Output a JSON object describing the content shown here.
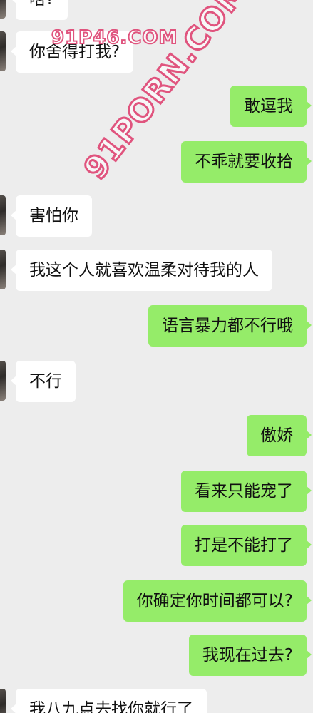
{
  "watermarks": {
    "top": "91P46.COM",
    "diagonal": "91PORN.COM"
  },
  "colors": {
    "background": "#ededed",
    "incoming_bubble": "#ffffff",
    "outgoing_bubble": "#95ec69",
    "text": "#111111"
  },
  "messages": [
    {
      "side": "left",
      "avatar": true,
      "text": "啥?"
    },
    {
      "side": "left",
      "avatar": true,
      "text": "你舍得打我?"
    },
    {
      "side": "right",
      "avatar": false,
      "text": "敢逗我"
    },
    {
      "side": "right",
      "avatar": false,
      "text": "不乖就要收拾"
    },
    {
      "side": "left",
      "avatar": true,
      "text": "害怕你"
    },
    {
      "side": "left",
      "avatar": true,
      "text": "我这个人就喜欢温柔对待我的人"
    },
    {
      "side": "right",
      "avatar": false,
      "text": "语言暴力都不行哦"
    },
    {
      "side": "left",
      "avatar": true,
      "text": "不行"
    },
    {
      "side": "right",
      "avatar": false,
      "text": "傲娇"
    },
    {
      "side": "right",
      "avatar": false,
      "text": "看来只能宠了"
    },
    {
      "side": "right",
      "avatar": false,
      "text": "打是不能打了"
    },
    {
      "side": "right",
      "avatar": false,
      "text": "你确定你时间都可以?"
    },
    {
      "side": "right",
      "avatar": false,
      "text": "我现在过去?"
    },
    {
      "side": "left",
      "avatar": true,
      "text": "我八九点去找你就行了"
    }
  ]
}
